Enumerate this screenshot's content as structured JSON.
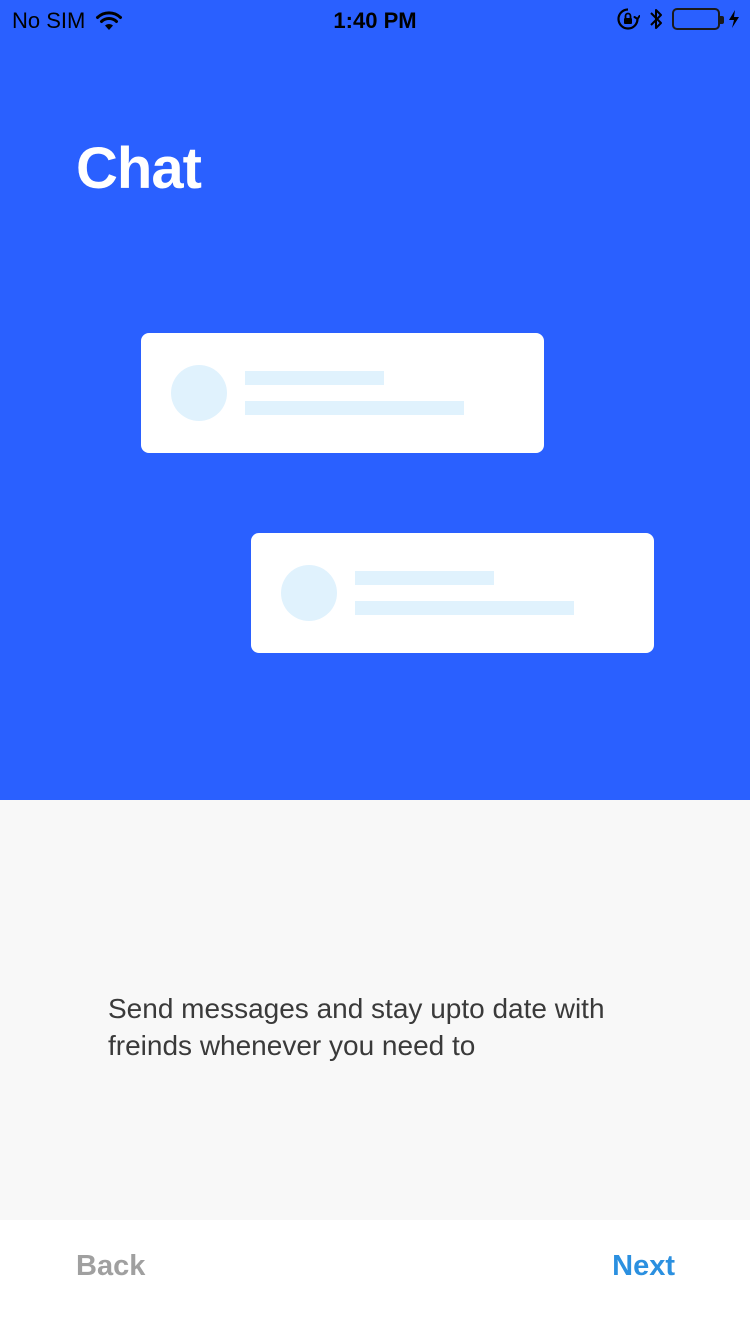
{
  "status_bar": {
    "carrier": "No SIM",
    "time": "1:40 PM",
    "battery_color": "#4cd964",
    "icons": [
      "wifi-icon",
      "orientation-lock-icon",
      "bluetooth-icon",
      "battery-icon",
      "charging-bolt-icon"
    ]
  },
  "hero": {
    "title": "Chat",
    "background_color": "#2a60ff"
  },
  "description": {
    "text": "Send messages and stay upto date with freinds whenever you need to"
  },
  "navigation": {
    "back_label": "Back",
    "next_label": "Next",
    "back_color": "#a0a0a0",
    "next_color": "#2b90e0"
  }
}
